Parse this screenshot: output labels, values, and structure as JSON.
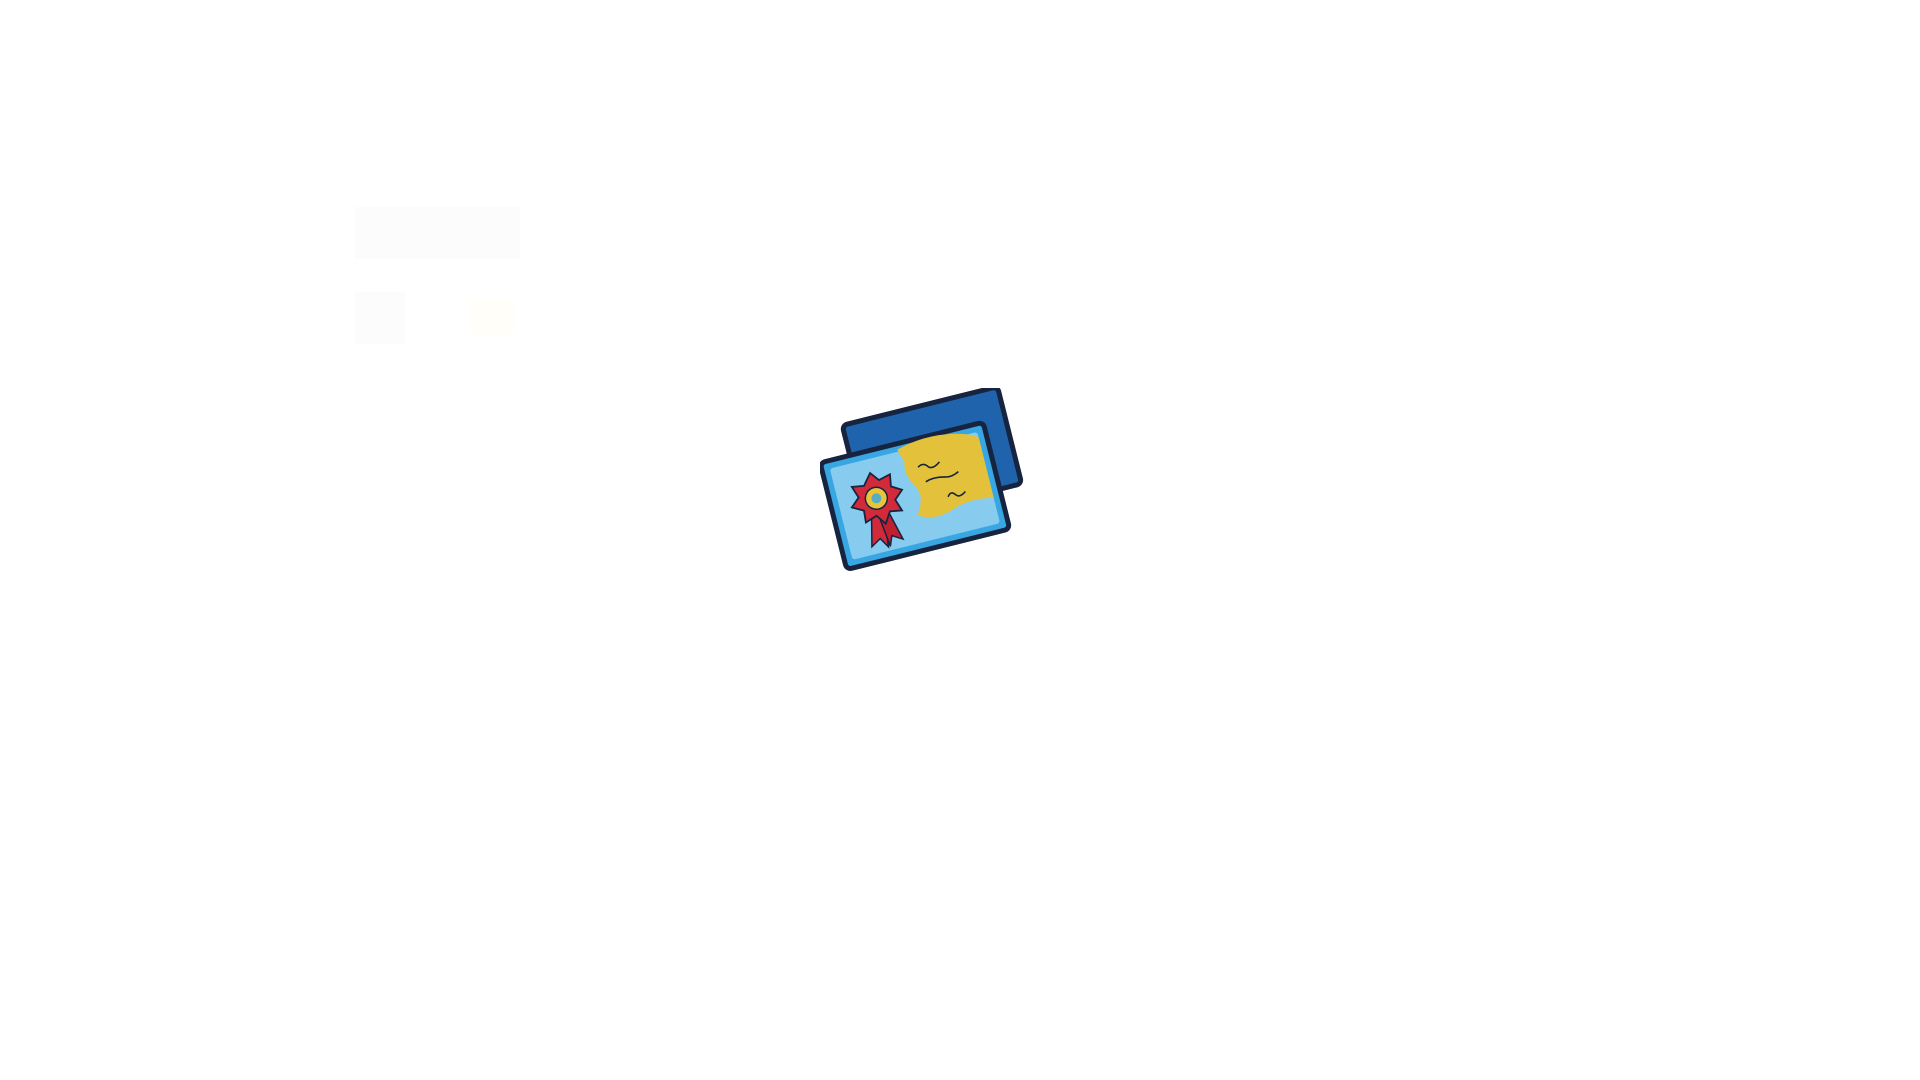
{
  "loader": {
    "icon": "certificate-cards-icon",
    "colors": {
      "back_card": "#1f63ad",
      "front_card": "#37a6e2",
      "front_inner": "#a9dcf5",
      "scroll": "#e3c13a",
      "ribbon": "#d22a3a",
      "seal": "#e8c43a",
      "outline": "#16243f"
    }
  }
}
